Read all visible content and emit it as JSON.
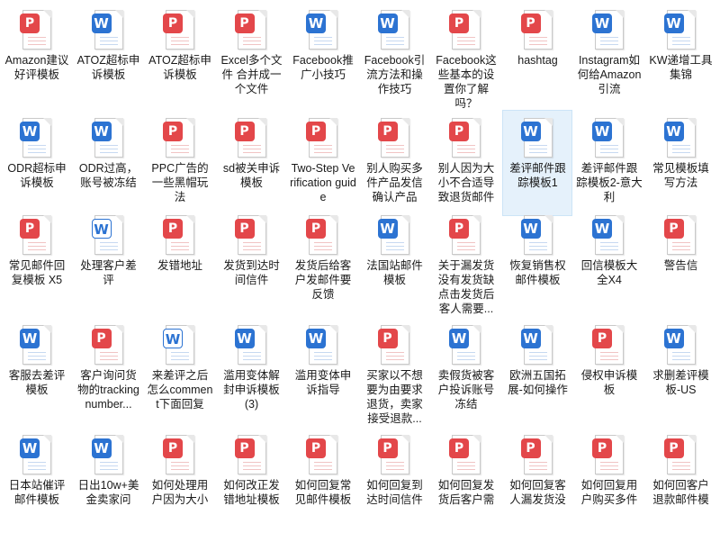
{
  "files": [
    {
      "name": "Amazon建议好评模板",
      "type": "pdf"
    },
    {
      "name": "ATOZ超标申诉模板",
      "type": "word"
    },
    {
      "name": "ATOZ超标申诉模板",
      "type": "pdf"
    },
    {
      "name": "Excel多个文件 合并成一个文件",
      "type": "pdf"
    },
    {
      "name": "Facebook推广小技巧",
      "type": "word"
    },
    {
      "name": "Facebook引流方法和操作技巧",
      "type": "word"
    },
    {
      "name": "Facebook这些基本的设置你了解吗？",
      "type": "pdf"
    },
    {
      "name": "hashtag",
      "type": "pdf"
    },
    {
      "name": "Instagram如何给Amazon引流",
      "type": "word"
    },
    {
      "name": "KW递增工具集锦",
      "type": "word"
    },
    {
      "name": "ODR超标申诉模板",
      "type": "word"
    },
    {
      "name": "ODR过高，账号被冻结",
      "type": "word"
    },
    {
      "name": "PPC广告的一些黑帽玩法",
      "type": "pdf"
    },
    {
      "name": "sd被关申诉模板",
      "type": "pdf"
    },
    {
      "name": "Two-Step Verification guide",
      "type": "pdf"
    },
    {
      "name": "别人购买多件产品发信确认产品",
      "type": "pdf"
    },
    {
      "name": "别人因为大小不合适导致退货邮件",
      "type": "pdf"
    },
    {
      "name": "差评邮件跟踪模板1",
      "type": "word",
      "selected": true
    },
    {
      "name": "差评邮件跟踪模板2-意大利",
      "type": "word"
    },
    {
      "name": "常见模板填写方法",
      "type": "word"
    },
    {
      "name": "常见邮件回复模板 X5",
      "type": "pdf"
    },
    {
      "name": "处理客户差评",
      "type": "word-light"
    },
    {
      "name": "发错地址",
      "type": "pdf"
    },
    {
      "name": "发货到达时间信件",
      "type": "pdf"
    },
    {
      "name": "发货后给客户发邮件要反馈",
      "type": "pdf"
    },
    {
      "name": "法国站邮件模板",
      "type": "word"
    },
    {
      "name": "关于漏发货没有发货缺点击发货后客人需要...",
      "type": "pdf"
    },
    {
      "name": "恢复销售权邮件模板",
      "type": "word"
    },
    {
      "name": "回信模板大全X4",
      "type": "word"
    },
    {
      "name": "警告信",
      "type": "pdf"
    },
    {
      "name": "客服去差评模板",
      "type": "word"
    },
    {
      "name": "客户询问货物的tracking number...",
      "type": "pdf"
    },
    {
      "name": "来差评之后怎么comment下面回复",
      "type": "word-light"
    },
    {
      "name": "滥用变体解封申诉模板(3)",
      "type": "word"
    },
    {
      "name": "滥用变体申诉指导",
      "type": "word"
    },
    {
      "name": "买家以不想要为由要求退货，卖家接受退款...",
      "type": "pdf"
    },
    {
      "name": "卖假货被客户投诉账号冻结",
      "type": "word"
    },
    {
      "name": "欧洲五国拓展-如何操作",
      "type": "word"
    },
    {
      "name": "侵权申诉模板",
      "type": "pdf"
    },
    {
      "name": "求删差评模板-US",
      "type": "word"
    },
    {
      "name": "日本站催评邮件模板",
      "type": "word"
    },
    {
      "name": "日出10w+美金卖家问",
      "type": "word"
    },
    {
      "name": "如何处理用户因为大小",
      "type": "pdf"
    },
    {
      "name": "如何改正发错地址模板",
      "type": "pdf"
    },
    {
      "name": "如何回复常见邮件模板",
      "type": "pdf"
    },
    {
      "name": "如何回复到达时间信件",
      "type": "pdf"
    },
    {
      "name": "如何回复发货后客户需",
      "type": "pdf"
    },
    {
      "name": "如何回复客人漏发货没",
      "type": "pdf"
    },
    {
      "name": "如何回复用户购买多件",
      "type": "pdf"
    },
    {
      "name": "如何回客户退款邮件模",
      "type": "pdf"
    }
  ],
  "glyphs": {
    "word": "W",
    "pdf": "P"
  }
}
